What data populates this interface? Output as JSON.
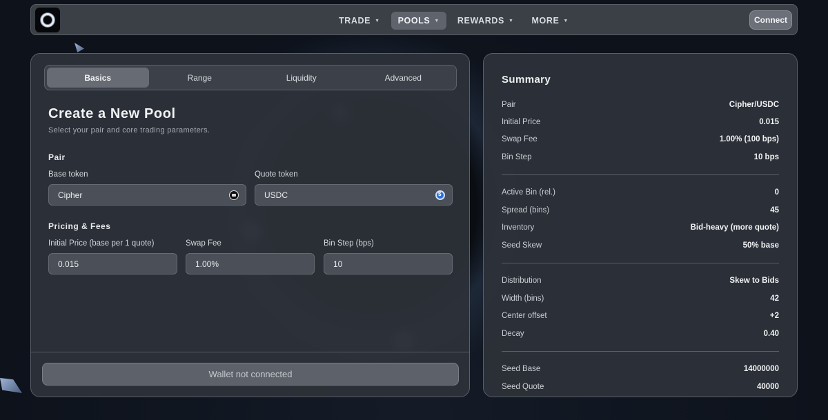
{
  "nav": {
    "menu": [
      {
        "label": "TRADE",
        "active": false
      },
      {
        "label": "POOLS",
        "active": true
      },
      {
        "label": "REWARDS",
        "active": false
      },
      {
        "label": "MORE",
        "active": false
      }
    ],
    "caret": "▼",
    "connect_label": "Connect"
  },
  "form": {
    "tabs": [
      "Basics",
      "Range",
      "Liquidity",
      "Advanced"
    ],
    "active_tab": "Basics",
    "title": "Create a New Pool",
    "subtitle": "Select your pair and core trading parameters.",
    "pair_section": "Pair",
    "base_label": "Base token",
    "base_value": "Cipher",
    "quote_label": "Quote token",
    "quote_value": "USDC",
    "pricing_section": "Pricing & Fees",
    "price_label": "Initial Price (base per 1 quote)",
    "price_value": "0.015",
    "fee_label": "Swap Fee",
    "fee_value": "1.00%",
    "binstep_label": "Bin Step (bps)",
    "binstep_value": "10",
    "wallet_button": "Wallet not connected"
  },
  "summary": {
    "title": "Summary",
    "rows": [
      {
        "k": "Pair",
        "v": "Cipher/USDC"
      },
      {
        "k": "Initial Price",
        "v": "0.015"
      },
      {
        "k": "Swap Fee",
        "v": "1.00% (100 bps)"
      },
      {
        "k": "Bin Step",
        "v": "10 bps"
      },
      {
        "k": "Active Bin (rel.)",
        "v": "0"
      },
      {
        "k": "Spread (bins)",
        "v": "45"
      },
      {
        "k": "Inventory",
        "v": "Bid-heavy (more quote)"
      },
      {
        "k": "Seed Skew",
        "v": "50% base"
      },
      {
        "k": "Distribution",
        "v": "Skew to Bids"
      },
      {
        "k": "Width (bins)",
        "v": "42"
      },
      {
        "k": "Center offset",
        "v": "+2"
      },
      {
        "k": "Decay",
        "v": "0.40"
      },
      {
        "k": "Seed Base",
        "v": "14000000"
      },
      {
        "k": "Seed Quote",
        "v": "40000"
      }
    ]
  }
}
